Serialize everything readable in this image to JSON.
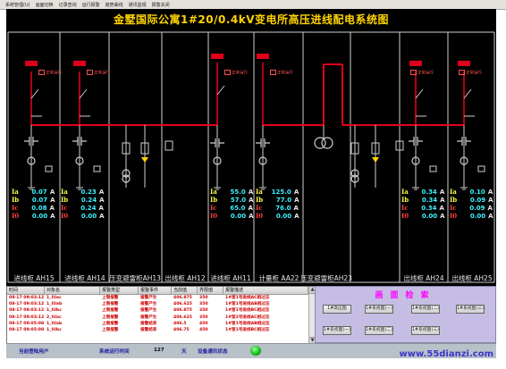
{
  "menu": [
    "系统管理(U)",
    "画面切换",
    "记录查询",
    "运行报警",
    "趋势曲线",
    "通讯监视",
    "报警关闭"
  ],
  "title": "金墅国际公寓1#20/0.4kV变电所高压进线配电系统图",
  "state_tag": "正常运行",
  "columns": [
    {
      "label": "进线柜 AH15"
    },
    {
      "label": "进线柜 AH14"
    },
    {
      "label": "压变避雷柜AH13"
    },
    {
      "label": "出线柜 AH12"
    },
    {
      "label": "进线柜 AH11"
    },
    {
      "label": "计量柜 AA22"
    },
    {
      "label": "压变避雷柜AH23"
    },
    {
      "label": "出线柜 AH24"
    },
    {
      "label": "出线柜 AH25"
    }
  ],
  "measure_names": [
    "Ia",
    "Ib",
    "Ic",
    "I0"
  ],
  "measure_unit": "A",
  "measurements": [
    {
      "values": [
        "0.07",
        "0.07",
        "0.08",
        "0.00"
      ]
    },
    {
      "values": [
        "0.23",
        "0.24",
        "0.24",
        "0.00"
      ]
    },
    {
      "values": [
        "55.0",
        "57.0",
        "65.0",
        "0.00"
      ]
    },
    {
      "values": [
        "125.0",
        "77.0",
        "76.0",
        "0.00"
      ]
    },
    {
      "values": [
        "0.34",
        "0.34",
        "0.34",
        "0.00"
      ]
    },
    {
      "values": [
        "0.10",
        "0.09",
        "0.09",
        "0.00"
      ]
    }
  ],
  "events": {
    "headers": [
      "时间",
      "对象名",
      "报警类型",
      "报警事件",
      "当前值",
      "界限值",
      "报警描述"
    ],
    "rows": [
      [
        "08-17 09:03:12",
        "1_IUac",
        "上限报警",
        "报警产生",
        "406.875",
        "350",
        "1#室1号进线AC相过压"
      ],
      [
        "08-17 09:03:12",
        "1_IUab",
        "上限报警",
        "报警产生",
        "406.625",
        "350",
        "1#室1号进线AB相过压"
      ],
      [
        "08-17 09:03:12",
        "1_IUbc",
        "上限报警",
        "报警产生",
        "406.875",
        "350",
        "1#室1号进线BC相过压"
      ],
      [
        "08-17 09:03:12",
        "2_IUac",
        "上限报警",
        "报警产生",
        "406.625",
        "350",
        "1#室2号进线AC相过压"
      ],
      [
        "08-17 09:05:08",
        "1_IUab",
        "上限报警",
        "报警结束",
        "406.5",
        "450",
        "1#室1号进线AB相过压"
      ],
      [
        "08-17 09:05:08",
        "1_IUbc",
        "上限报警",
        "报警结束",
        "406.75",
        "450",
        "1#室1号进线BC相过压"
      ]
    ]
  },
  "nav": {
    "title": "画面检索",
    "buttons": [
      "1#高压图",
      "1#系统图(一)",
      "1#系统图(二)",
      "1#系统图(三)",
      "1#系统图(一)",
      "1#系统图(二)",
      "1#系统图(三)"
    ]
  },
  "status": {
    "user_label": "当前登陆用户",
    "runtime_label": "系统运行时间",
    "runtime_value": "127",
    "runtime_unit": "天",
    "comm_label": "设备通讯状态"
  },
  "watermark": "www.55dianzi.com",
  "colors": {
    "busbar": "#e0001a",
    "value": "#3cf0ff",
    "title": "#ffd400",
    "background": "#000000"
  }
}
